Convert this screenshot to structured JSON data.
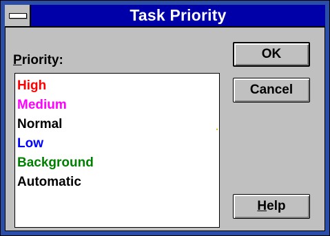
{
  "window": {
    "title": "Task Priority"
  },
  "label": {
    "prefix_underlined": "P",
    "rest": "riority:"
  },
  "list": {
    "items": [
      {
        "label": "High",
        "color": "#ff0000"
      },
      {
        "label": "Medium",
        "color": "#ff00ff"
      },
      {
        "label": "Normal",
        "color": "#000000"
      },
      {
        "label": "Low",
        "color": "#0000ff"
      },
      {
        "label": "Background",
        "color": "#008000"
      },
      {
        "label": "Automatic",
        "color": "#000000"
      }
    ]
  },
  "buttons": {
    "ok": "OK",
    "cancel": "Cancel",
    "help_underlined": "H",
    "help_rest": "elp"
  },
  "colors": {
    "titlebar": "#0000a8",
    "frame": "#2a4ea8",
    "face": "#c0c0c0"
  },
  "icons": {
    "system_menu": "system-menu-icon"
  }
}
